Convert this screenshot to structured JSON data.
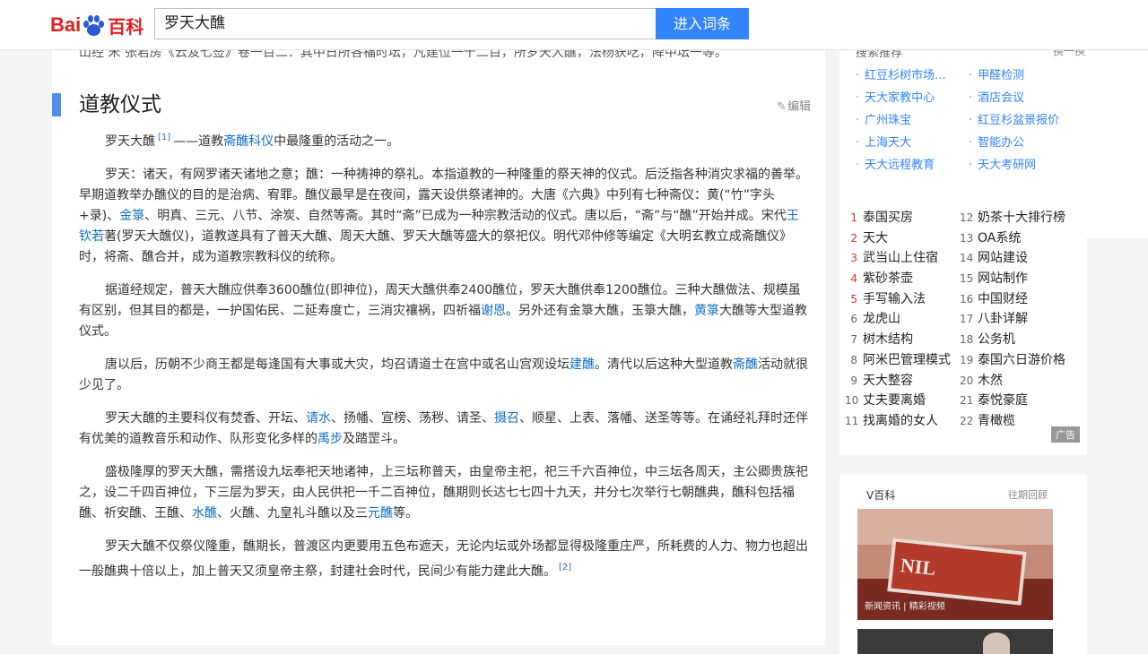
{
  "header": {
    "logo_text_left": "Bai",
    "logo_text_right": "百科",
    "search_value": "罗天大醮",
    "search_button": "进入词条"
  },
  "article": {
    "cut_line": "山经 宋 张君房《云笈七签》卷一百二：其中日所各福时坛，凡建位一千二百，所罗天大醮，法杨获吃，降中坛一等。",
    "section_title": "道教仪式",
    "edit_label": "编辑",
    "paragraphs": [
      {
        "segments": [
          {
            "t": "罗天大醮"
          },
          {
            "t": "[1]",
            "ref": true
          },
          {
            "t": "——道教"
          },
          {
            "t": "斋醮科仪",
            "link": true
          },
          {
            "t": "中最隆重的活动之一。"
          }
        ]
      },
      {
        "segments": [
          {
            "t": "罗天：诸天，有网罗诸天诸地之意；醮：一种祷神的祭礼。本指道教的一种隆重的祭天神的仪式。后泛指各种消灾求福的善举。早期道教举办醮仪的目的是治病、宥罪。醮仪最早是在夜间，露天设供祭诸神的。大唐《六典》中列有七种斋仪：黄(“竹”字头+录)、"
          },
          {
            "t": "金箓",
            "link": true
          },
          {
            "t": "、明真、三元、八节、涂炭、自然等斋。其时“斋”已成为一种宗教活动的仪式。唐以后，“斋”与“醮”开始并成。宋代"
          },
          {
            "t": "王钦若",
            "link": true
          },
          {
            "t": "著(罗天大醮仪)，道教遂具有了普天大醮、周天大醮、罗天大醮等盛大的祭祀仪。明代邓仲修等编定《大明玄教立成斋醮仪》时，将斋、醮合并，成为道教宗教科仪的统称。"
          }
        ]
      },
      {
        "segments": [
          {
            "t": "据道经规定，普天大醮应供奉3600醮位(即神位)，周天大醮供奉2400醮位，罗天大醮供奉1200醮位。三种大醮做法、规模虽有区别，但其目的都是，一护国佑民、二延寿度亡，三消灾禳祸，四祈福"
          },
          {
            "t": "谢恩",
            "link": true
          },
          {
            "t": "。另外还有金箓大醮，玉箓大醮，"
          },
          {
            "t": "黄箓",
            "link": true
          },
          {
            "t": "大醮等大型道教仪式。"
          }
        ]
      },
      {
        "segments": [
          {
            "t": "唐以后，历朝不少商王都是每逢国有大事或大灾，均召请道士在宫中或名山宫观设坛"
          },
          {
            "t": "建醮",
            "link": true
          },
          {
            "t": "。清代以后这种大型道教"
          },
          {
            "t": "斋醮",
            "link": true
          },
          {
            "t": "活动就很少见了。"
          }
        ]
      },
      {
        "segments": [
          {
            "t": "罗天大醮的主要科仪有焚香、开坛、"
          },
          {
            "t": "请水",
            "link": true
          },
          {
            "t": "、扬幡、宣榜、荡秽、请圣、"
          },
          {
            "t": "摄召",
            "link": true
          },
          {
            "t": "、顺星、上表、落幡、送圣等等。在诵经礼拜时还伴有优美的道教音乐和动作、队形变化多样的"
          },
          {
            "t": "禹步",
            "link": true
          },
          {
            "t": "及踏罡斗。"
          }
        ]
      },
      {
        "segments": [
          {
            "t": "盛极隆厚的罗天大醮，需搭设九坛奉祀天地诸神，上三坛称普天，由皇帝主祀，祀三千六百神位，中三坛各周天，主公卿贵族祀之，设二千四百神位，下三层为罗天，由人民供祀一千二百神位，醮期则长达七七四十九天，并分七次举行七朝醮典，醮科包括福醮、祈安醮、王醮、"
          },
          {
            "t": "水醮",
            "link": true
          },
          {
            "t": "、火醮、九皇礼斗醮以及三"
          },
          {
            "t": "元醮",
            "link": true
          },
          {
            "t": "等。"
          }
        ]
      },
      {
        "segments": [
          {
            "t": "罗天大醮不仅祭仪隆重，醮期长，普渡区内更要用五色布遮天，无论内坛或外场都显得极隆重庄严，所耗费的人力、物力也超出一般醮典十倍以上，加上普天又须皇帝主祭，封建社会时代，民间少有能力建此大醮。"
          },
          {
            "t": "[2]",
            "ref": true
          }
        ]
      }
    ]
  },
  "sidebar": {
    "recommend_title": "搜索推荐",
    "recommend_swap": "换一换",
    "recommend_left": [
      "红豆杉树市场...",
      "天大家教中心",
      "广州珠宝",
      "上海天大",
      "天大远程教育"
    ],
    "recommend_right": [
      "甲醛检测",
      "酒店会议",
      "红豆杉盆景报价",
      "智能办公",
      "天大考研网"
    ],
    "rank_left": [
      {
        "n": "1",
        "t": "泰国买房"
      },
      {
        "n": "2",
        "t": "天大"
      },
      {
        "n": "3",
        "t": "武当山上住宿"
      },
      {
        "n": "4",
        "t": "紫砂茶壶"
      },
      {
        "n": "5",
        "t": "手写输入法"
      },
      {
        "n": "6",
        "t": "龙虎山"
      },
      {
        "n": "7",
        "t": "树木结构"
      },
      {
        "n": "8",
        "t": "阿米巴管理模式"
      },
      {
        "n": "9",
        "t": "天大整容"
      },
      {
        "n": "10",
        "t": "丈夫要离婚"
      },
      {
        "n": "11",
        "t": "找离婚的女人"
      }
    ],
    "rank_right": [
      {
        "n": "12",
        "t": "奶茶十大排行榜"
      },
      {
        "n": "13",
        "t": "OA系统"
      },
      {
        "n": "14",
        "t": "网站建设"
      },
      {
        "n": "15",
        "t": "网站制作"
      },
      {
        "n": "16",
        "t": "中国财经"
      },
      {
        "n": "17",
        "t": "八卦详解"
      },
      {
        "n": "18",
        "t": "公务机"
      },
      {
        "n": "19",
        "t": "泰国六日游价格"
      },
      {
        "n": "20",
        "t": "木然"
      },
      {
        "n": "21",
        "t": "泰悦豪庭"
      },
      {
        "n": "22",
        "t": "青橄榄"
      }
    ],
    "ad_label": "广告",
    "vbaike_title": "V百科",
    "vbaike_more": "往期回顾",
    "vbaike_sign": "NIL",
    "vbaike_caption": "新闻资讯 | 精彩视频"
  },
  "colors": {
    "accent": "#3385ff",
    "link": "#136ec2",
    "section_bar": "#4e8fe8",
    "hot_rank": "#e0332b"
  }
}
